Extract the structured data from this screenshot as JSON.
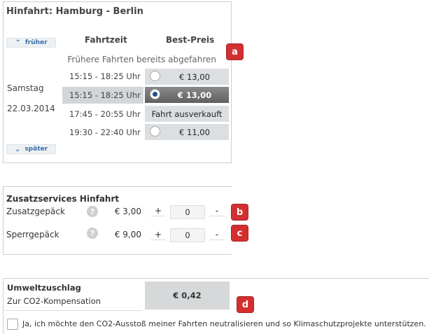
{
  "hinfahrt": {
    "title": "Hinfahrt: Hamburg - Berlin",
    "col_fahrtzeit": "Fahrtzeit",
    "col_bestpreis": "Best-Preis",
    "earlier_label": "früher",
    "later_label": "später",
    "info_text": "Frühere Fahrten bereits abgefahren",
    "day_name": "Samstag",
    "day_date": "22.03.2014",
    "connections": [
      {
        "time": "15:15 - 18:25 Uhr",
        "price": "€ 13,00",
        "selected": false
      },
      {
        "time": "15:15 - 18:25 Uhr",
        "price": "€ 13,00",
        "selected": true
      },
      {
        "time": "17:45 - 20:55 Uhr",
        "price": "Fahrt ausverkauft",
        "selected": false
      },
      {
        "time": "19:30 - 22:40 Uhr",
        "price": "€ 11,00",
        "selected": false
      }
    ],
    "badge": "a"
  },
  "zusatzservices": {
    "title": "Zusatzservices Hinfahrt",
    "items": [
      {
        "label": "Zusatzgepäck",
        "price": "€ 3,00",
        "plus": "+",
        "qty": "0",
        "minus": "-",
        "badge": "b"
      },
      {
        "label": "Sperrgepäck",
        "price": "€ 9,00",
        "plus": "+",
        "qty": "0",
        "minus": "-",
        "badge": "c"
      }
    ],
    "help_glyph": "?"
  },
  "umwelt": {
    "title": "Umweltzuschlag",
    "subtitle": "Zur CO2-Kompensation",
    "amount": "€ 0,42",
    "badge": "d",
    "checkbox_label": "Ja, ich möchte den CO2-Ausstoß meiner Fahrten neutralisieren und so Klimaschutzprojekte unterstützen."
  },
  "colors": {
    "badge_red": "#d32f2f",
    "radio_selected": "#1e4f8f",
    "nav_blue": "#3a6ea5"
  },
  "icons": {
    "earlier": "chevron-up-icon",
    "later": "chevron-down-icon",
    "help": "help-icon"
  }
}
